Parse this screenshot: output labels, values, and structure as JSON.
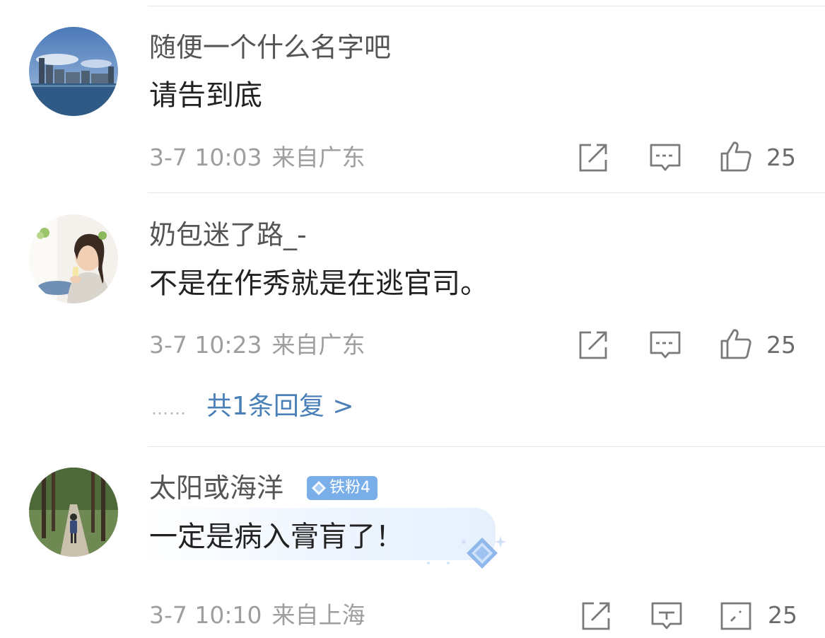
{
  "comments": [
    {
      "username": "随便一个什么名字吧",
      "content": "请告到底",
      "date_time": "3-7 10:03",
      "location": "来自广东",
      "likes": "25",
      "avatar_icon": "city-waterfront-photo"
    },
    {
      "username": "奶包迷了路_-",
      "content": "不是在作秀就是在逃官司。",
      "date_time": "3-7 10:23",
      "location": "来自广东",
      "likes": "25",
      "avatar_icon": "woman-portrait-photo",
      "replies_link": "共1条回复 >",
      "replies_dots": "……"
    },
    {
      "username": "太阳或海洋",
      "badge": "铁粉4",
      "content": "一定是病入膏肓了！",
      "date_time": "3-7 10:10",
      "location": "来自上海",
      "likes": "25",
      "avatar_icon": "forest-path-photo"
    }
  ],
  "colors": {
    "link": "#4a7fb8",
    "badge": "#7aaee8",
    "meta": "#9e9e9e"
  },
  "icons": [
    "share-icon",
    "comment-icon",
    "like-icon",
    "diamond-icon"
  ]
}
